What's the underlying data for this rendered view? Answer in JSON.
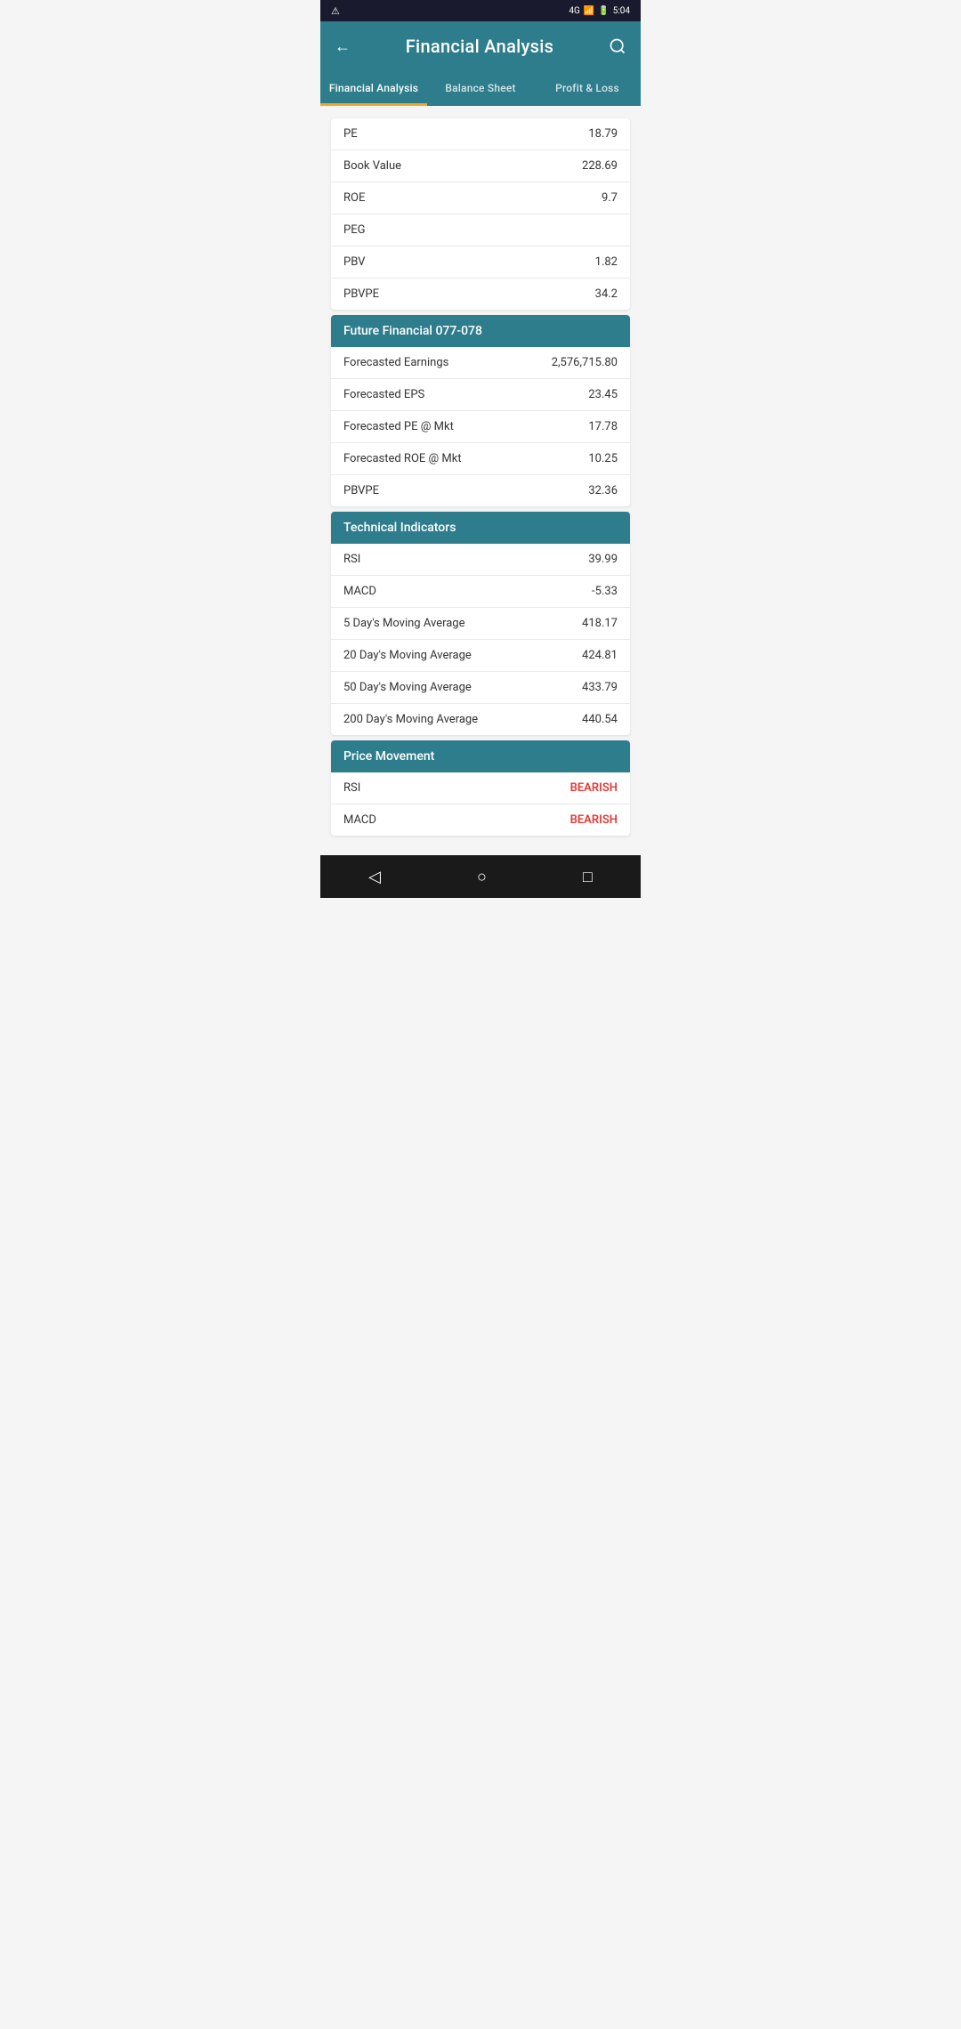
{
  "statusBar": {
    "warning": "⚠",
    "network": "4G",
    "battery": "🔋",
    "time": "5:04"
  },
  "header": {
    "title": "Financial Analysis",
    "backIcon": "←",
    "searchIcon": "🔍"
  },
  "tabs": [
    {
      "id": "financial-analysis",
      "label": "Financial Analysis",
      "active": true
    },
    {
      "id": "balance-sheet",
      "label": "Balance Sheet",
      "active": false
    },
    {
      "id": "profit-loss",
      "label": "Profit & Loss",
      "active": false
    }
  ],
  "partialRows": [
    {
      "label": "PE",
      "value": "18.79"
    },
    {
      "label": "Book Value",
      "value": "228.69"
    },
    {
      "label": "ROE",
      "value": "9.7"
    },
    {
      "label": "PEG",
      "value": ""
    },
    {
      "label": "PBV",
      "value": "1.82"
    },
    {
      "label": "PBVPE",
      "value": "34.2"
    }
  ],
  "sections": [
    {
      "id": "future-financial",
      "title": "Future Financial 077-078",
      "rows": [
        {
          "label": "Forecasted Earnings",
          "value": "2,576,715.80",
          "style": "normal"
        },
        {
          "label": "Forecasted EPS",
          "value": "23.45",
          "style": "normal"
        },
        {
          "label": "Forecasted PE @ Mkt",
          "value": "17.78",
          "style": "normal"
        },
        {
          "label": "Forecasted ROE @ Mkt",
          "value": "10.25",
          "style": "normal"
        },
        {
          "label": "PBVPE",
          "value": "32.36",
          "style": "normal"
        }
      ]
    },
    {
      "id": "technical-indicators",
      "title": "Technical Indicators",
      "rows": [
        {
          "label": "RSI",
          "value": "39.99",
          "style": "normal"
        },
        {
          "label": "MACD",
          "value": "-5.33",
          "style": "normal"
        },
        {
          "label": "5 Day's Moving Average",
          "value": "418.17",
          "style": "normal"
        },
        {
          "label": "20 Day's Moving Average",
          "value": "424.81",
          "style": "normal"
        },
        {
          "label": "50 Day's Moving Average",
          "value": "433.79",
          "style": "normal"
        },
        {
          "label": "200 Day's Moving Average",
          "value": "440.54",
          "style": "normal"
        }
      ]
    },
    {
      "id": "price-movement",
      "title": "Price Movement",
      "rows": [
        {
          "label": "RSI",
          "value": "BEARISH",
          "style": "bearish"
        },
        {
          "label": "MACD",
          "value": "BEARISH",
          "style": "bearish"
        }
      ]
    }
  ],
  "bottomNav": {
    "backIcon": "◁",
    "homeIcon": "○",
    "recentIcon": "□"
  }
}
